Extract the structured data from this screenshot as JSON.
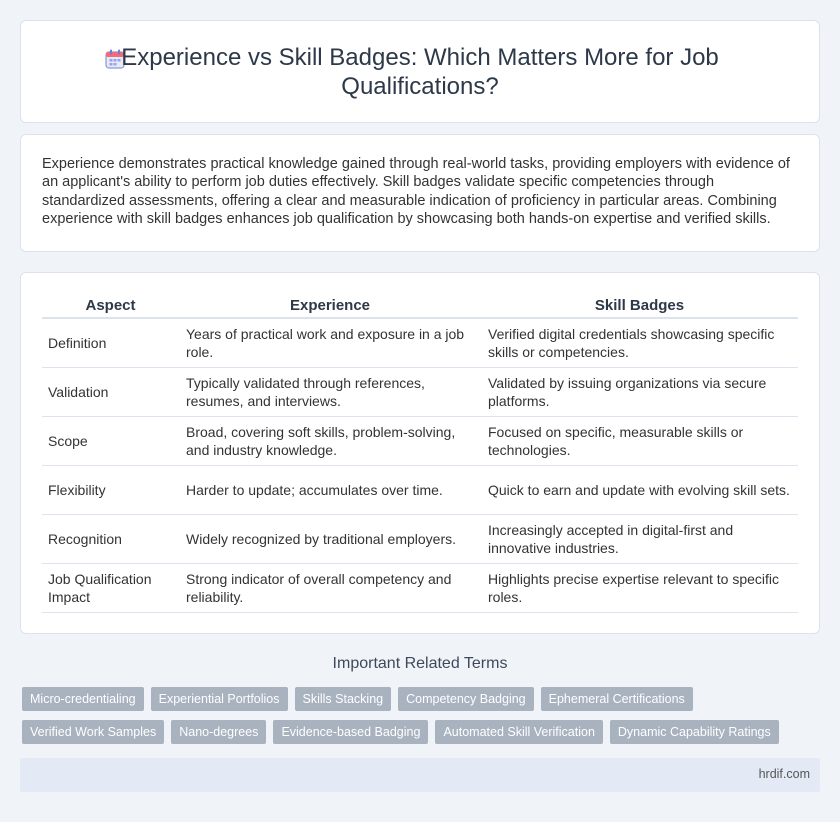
{
  "header": {
    "icon": "calendar-icon",
    "title": "Experience vs Skill Badges: Which Matters More for Job Qualifications?"
  },
  "intro": {
    "text": "Experience demonstrates practical knowledge gained through real-world tasks, providing employers with evidence of an applicant's ability to perform job duties effectively. Skill badges validate specific competencies through standardized assessments, offering a clear and measurable indication of proficiency in particular areas. Combining experience with skill badges enhances job qualification by showcasing both hands-on expertise and verified skills."
  },
  "table": {
    "headers": [
      "Aspect",
      "Experience",
      "Skill Badges"
    ],
    "rows": [
      [
        "Definition",
        "Years of practical work and exposure in a job role.",
        "Verified digital credentials showcasing specific skills or competencies."
      ],
      [
        "Validation",
        "Typically validated through references, resumes, and interviews.",
        "Validated by issuing organizations via secure platforms."
      ],
      [
        "Scope",
        "Broad, covering soft skills, problem-solving, and industry knowledge.",
        "Focused on specific, measurable skills or technologies."
      ],
      [
        "Flexibility",
        "Harder to update; accumulates over time.",
        "Quick to earn and update with evolving skill sets."
      ],
      [
        "Recognition",
        "Widely recognized by traditional employers.",
        "Increasingly accepted in digital-first and innovative industries."
      ],
      [
        "Job Qualification Impact",
        "Strong indicator of overall competency and reliability.",
        "Highlights precise expertise relevant to specific roles."
      ]
    ]
  },
  "related": {
    "title": "Important Related Terms",
    "tags": [
      "Micro-credentialing",
      "Experiential Portfolios",
      "Skills Stacking",
      "Competency Badging",
      "Ephemeral Certifications",
      "Verified Work Samples",
      "Nano-degrees",
      "Evidence-based Badging",
      "Automated Skill Verification",
      "Dynamic Capability Ratings"
    ]
  },
  "footer": {
    "site": "hrdif.com"
  },
  "colors": {
    "background": "#f0f3f8",
    "card": "#ffffff",
    "tag": "#a9b2bf",
    "footer": "#e3eaf5"
  }
}
